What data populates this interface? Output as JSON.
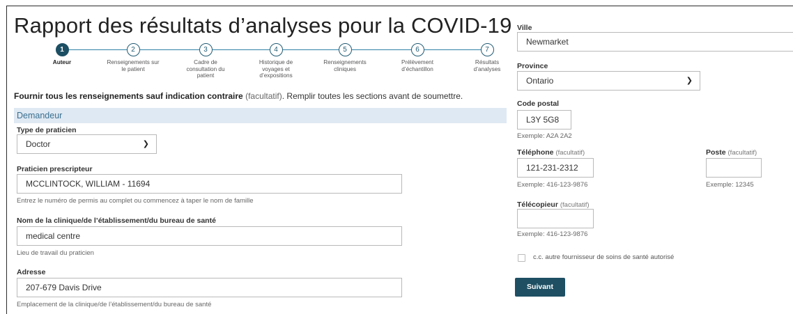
{
  "title": "Rapport des résultats d’analyses pour la COVID-19",
  "stepper": {
    "steps": [
      {
        "number": "1",
        "label": "Auteur"
      },
      {
        "number": "2",
        "label": "Renseignements sur le patient"
      },
      {
        "number": "3",
        "label": "Cadre de consultation du patient"
      },
      {
        "number": "4",
        "label": "Historique de voyages et d’expositions"
      },
      {
        "number": "5",
        "label": "Renseignements cliniques"
      },
      {
        "number": "6",
        "label": "Prélèvement d’échantillon"
      },
      {
        "number": "7",
        "label": "Résultats d’analyses"
      }
    ],
    "active_step": 1
  },
  "instructions": {
    "bold": "Fournir tous les renseignements sauf indication contraire",
    "optional": "(facultatif)",
    "rest": ". Remplir toutes les sections avant de soumettre."
  },
  "section": {
    "title": "Demandeur"
  },
  "form": {
    "type_praticien": {
      "label": "Type de praticien",
      "value": "Doctor"
    },
    "praticien_prescripteur": {
      "label": "Praticien prescripteur",
      "value": "MCCLINTOCK, WILLIAM - 11694",
      "help": "Entrez le numéro de permis au complet ou commencez à taper le nom de famille"
    },
    "clinique": {
      "label": "Nom de la clinique/de l’établissement/du bureau de santé",
      "value": "medical centre",
      "help": "Lieu de travail du praticien"
    },
    "adresse": {
      "label": "Adresse",
      "value": "207-679 Davis Drive",
      "help": "Emplacement de la clinique/de l’établissement/du bureau de santé"
    },
    "ville": {
      "label": "Ville",
      "value": "Newmarket"
    },
    "province": {
      "label": "Province",
      "value": "Ontario"
    },
    "code_postal": {
      "label": "Code postal",
      "value": "L3Y 5G8",
      "help": "Exemple: A2A 2A2"
    },
    "telephone": {
      "label": "Téléphone",
      "optional": "(facultatif)",
      "value": "121-231-2312",
      "help": "Exemple: 416-123-9876"
    },
    "poste": {
      "label": "Poste",
      "optional": "(facultatif)",
      "value": "",
      "help": "Exemple: 12345"
    },
    "telecopieur": {
      "label": "Télécopieur",
      "optional": "(facultatif)",
      "value": "",
      "help": "Exemple: 416-123-9876"
    },
    "cc_checkbox": {
      "label": "c.c. autre fournisseur de soins de santé autorisé",
      "checked": false
    }
  },
  "next_button": {
    "label": "Suivant"
  },
  "icons": {
    "dropdown": "chevron-down-icon"
  },
  "colors": {
    "accent": "#1e4f63",
    "section_bg": "#dfe9f3",
    "section_text": "#3a6f8f"
  }
}
